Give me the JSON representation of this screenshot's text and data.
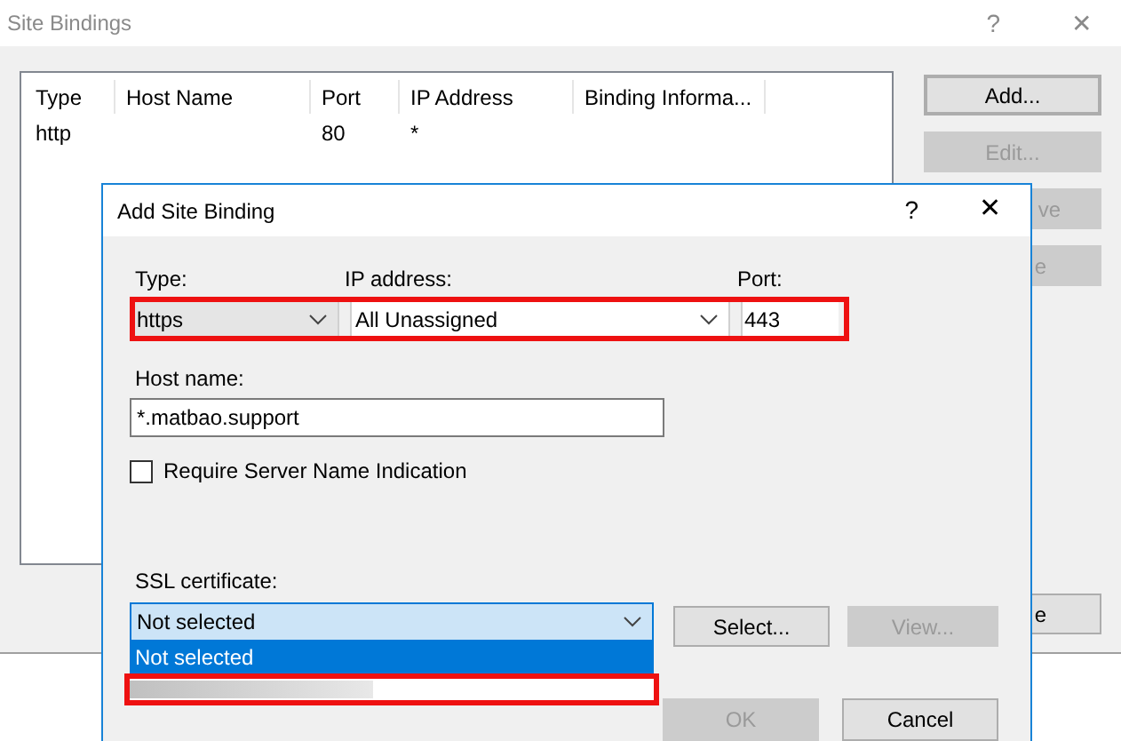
{
  "window": {
    "title": "Site Bindings",
    "help": "?",
    "close": "✕"
  },
  "table": {
    "columns": [
      "Type",
      "Host Name",
      "Port",
      "IP Address",
      "Binding Informa..."
    ],
    "rows": [
      [
        "http",
        "",
        "80",
        "*",
        ""
      ]
    ]
  },
  "side_buttons": [
    {
      "label": "Add...",
      "disabled": false,
      "focused": true
    },
    {
      "label": "Edit...",
      "disabled": true,
      "focused": false
    },
    {
      "label": "ve",
      "disabled": true,
      "focused": false
    },
    {
      "label": "e",
      "disabled": true,
      "focused": false
    }
  ],
  "bottom_button": {
    "label": "e"
  },
  "dialog": {
    "title": "Add Site Binding",
    "help": "?",
    "close": "✕",
    "type": {
      "label": "Type:",
      "value": "https"
    },
    "ip": {
      "label": "IP address:",
      "value": "All Unassigned"
    },
    "port": {
      "label": "Port:",
      "value": "443"
    },
    "host": {
      "label": "Host name:",
      "value": "*.matbao.support"
    },
    "sni": {
      "label": "Require Server Name Indication",
      "checked": false
    },
    "ssl": {
      "label": "SSL certificate:",
      "value": "Not selected",
      "options": [
        {
          "kind": "text",
          "label": "Not selected",
          "selected": true
        },
        {
          "kind": "redacted",
          "selected": false
        }
      ]
    },
    "buttons": [
      {
        "label": "Select...",
        "disabled": false
      },
      {
        "label": "View...",
        "disabled": true
      }
    ],
    "footer": [
      {
        "label": "OK",
        "disabled": true
      },
      {
        "label": "Cancel",
        "disabled": false
      }
    ]
  }
}
